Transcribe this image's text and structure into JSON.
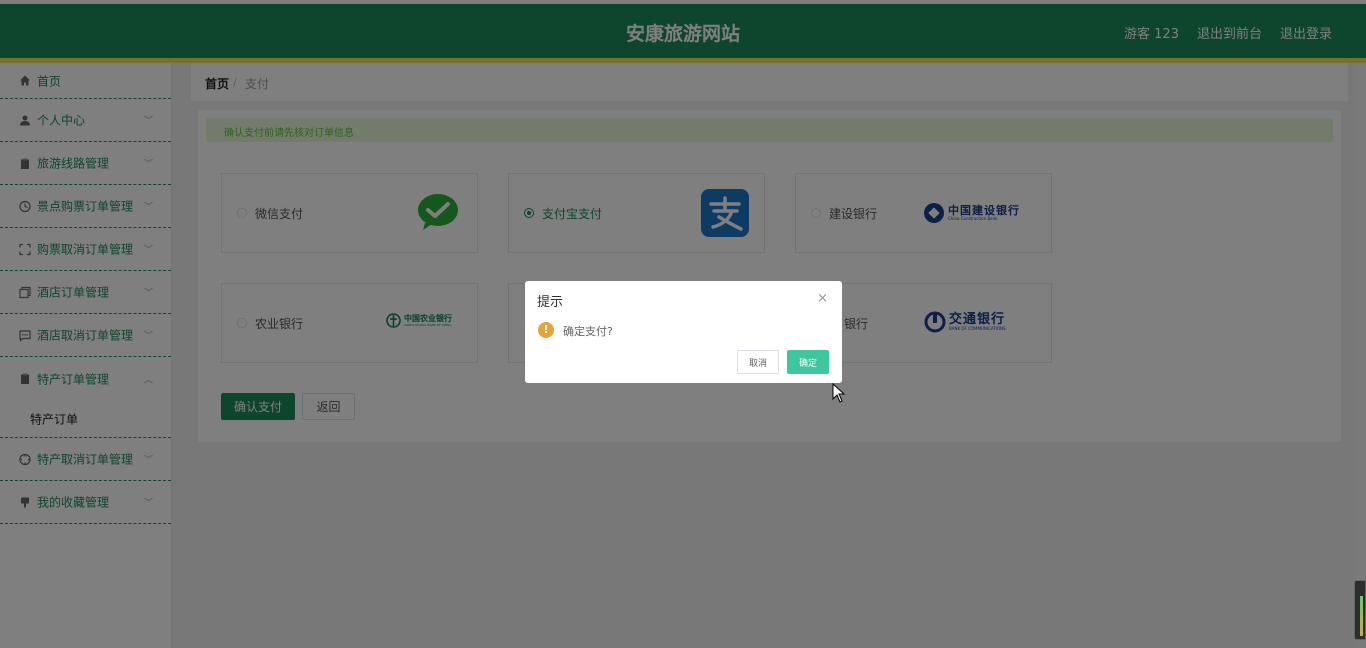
{
  "header": {
    "title": "安康旅游网站",
    "user": "游客 123",
    "front": "退出到前台",
    "logout": "退出登录"
  },
  "sidebar": {
    "items": [
      {
        "label": "首页",
        "icon": "home-icon"
      },
      {
        "label": "个人中心",
        "icon": "user-icon"
      },
      {
        "label": "旅游线路管理",
        "icon": "clipboard-icon"
      },
      {
        "label": "景点购票订单管理",
        "icon": "clock-icon"
      },
      {
        "label": "购票取消订单管理",
        "icon": "fullscreen-icon"
      },
      {
        "label": "酒店订单管理",
        "icon": "copy-icon"
      },
      {
        "label": "酒店取消订单管理",
        "icon": "chat-icon"
      },
      {
        "label": "特产订单管理",
        "icon": "clipboard-icon"
      },
      {
        "label": "特产取消订单管理",
        "icon": "compass-icon"
      },
      {
        "label": "我的收藏管理",
        "icon": "collection-icon"
      }
    ],
    "submenu": "特产订单"
  },
  "breadcrumb": {
    "home": "首页",
    "separator": "/",
    "current": "支付"
  },
  "alert": "确认支付前请先核对订单信息",
  "payments": [
    {
      "label": "微信支付",
      "logo": "wechat-logo",
      "selected": false
    },
    {
      "label": "支付宝支付",
      "logo": "alipay-logo",
      "selected": true
    },
    {
      "label": "建设银行",
      "logo": "ccb-logo",
      "selected": false
    },
    {
      "label": "农业银行",
      "logo": "abc-logo",
      "selected": false
    },
    {
      "label": "银行",
      "logo": "bocom-logo",
      "selected": false
    }
  ],
  "logos": {
    "ccb": "中国建设银行",
    "ccb_en": "China Construction Bank",
    "abc": "中国农业银行",
    "abc_en": "AGRICULTURAL BANK OF CHINA",
    "bocom": "交通银行",
    "bocom_en": "BANK OF COMMUNICATIONS"
  },
  "buttons": {
    "confirm": "确认支付",
    "back": "返回"
  },
  "dialog": {
    "title": "提示",
    "close": "×",
    "warn": "!",
    "message": "确定支付?",
    "cancel": "取消",
    "ok": "确定"
  },
  "colors": {
    "brand": "#1d8a5a",
    "accent_bar": "#e9e35b",
    "dialog_ok": "#3ec69e",
    "warning": "#e6a23c"
  }
}
